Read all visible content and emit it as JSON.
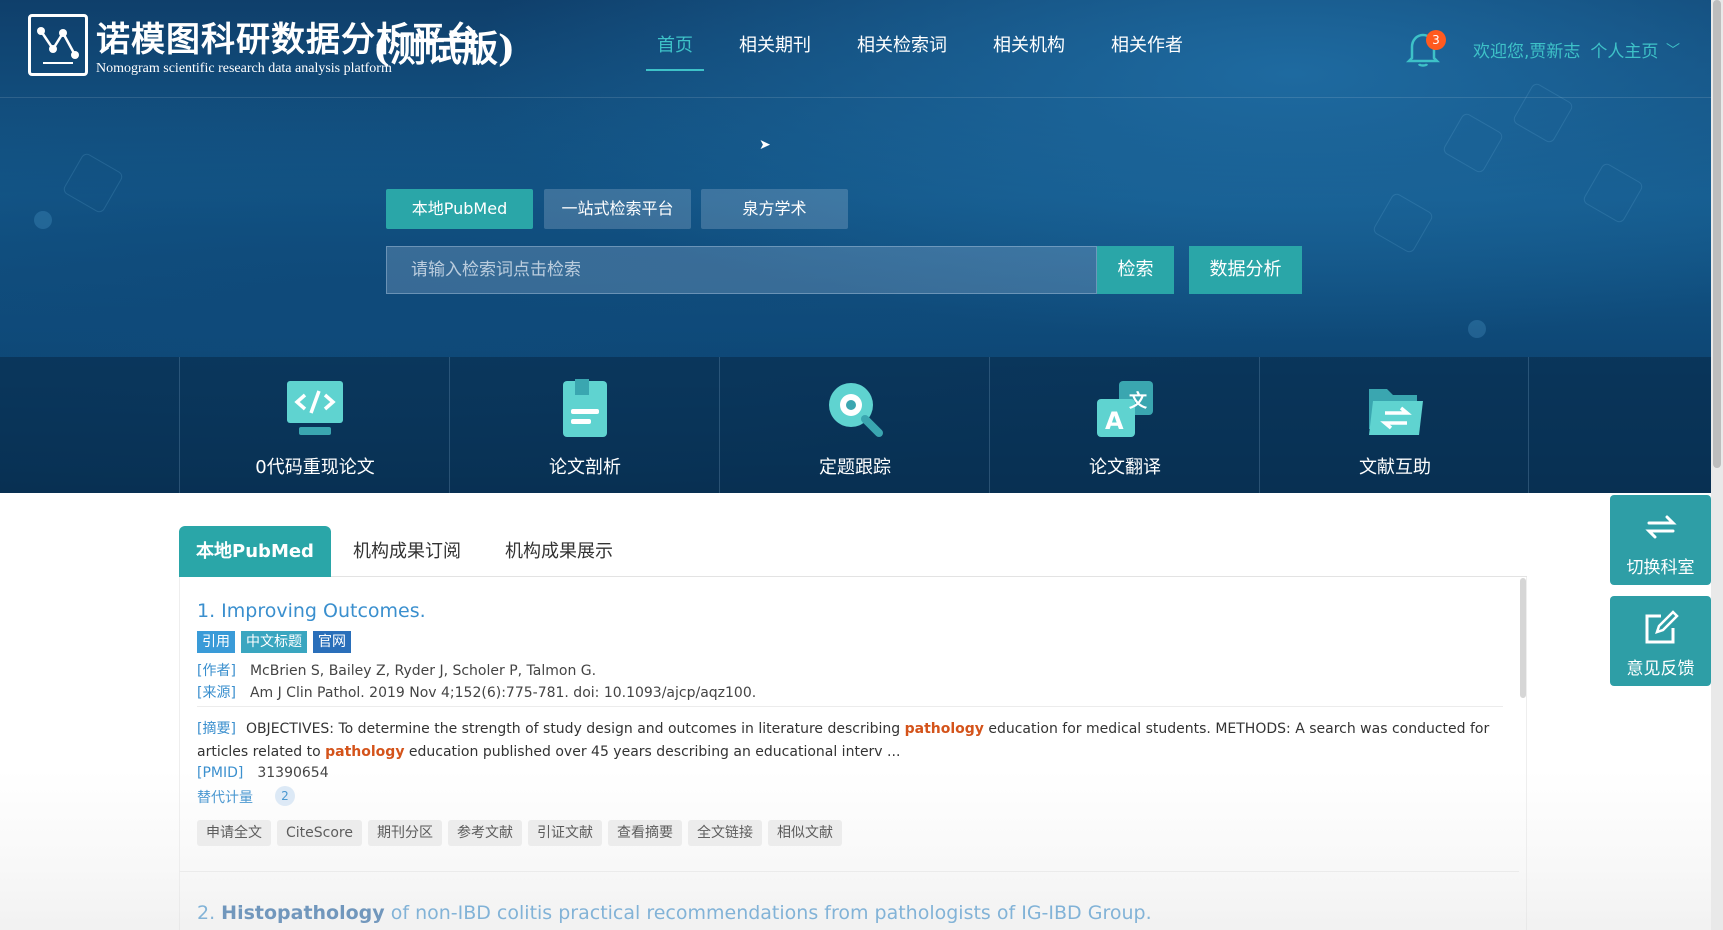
{
  "header": {
    "logo_title": "诺模图科研数据分析平台",
    "logo_subtitle": "Nomogram scientific research data analysis platform",
    "logo_badge": "(测试版)",
    "nav": [
      {
        "label": "首页",
        "active": true
      },
      {
        "label": "相关期刊"
      },
      {
        "label": "相关检索词"
      },
      {
        "label": "相关机构"
      },
      {
        "label": "相关作者"
      }
    ],
    "notification_count": "3",
    "welcome": "欢迎您,贾新志",
    "profile": "个人主页"
  },
  "search": {
    "tabs": [
      "本地PubMed",
      "一站式检索平台",
      "泉方学术"
    ],
    "active_tab": "本地PubMed",
    "placeholder": "请输入检索词点击检索",
    "search_button": "检索",
    "analysis_button": "数据分析"
  },
  "features": [
    {
      "label": "0代码重现论文",
      "icon": "code-icon"
    },
    {
      "label": "论文剖析",
      "icon": "document-icon"
    },
    {
      "label": "定题跟踪",
      "icon": "target-search-icon"
    },
    {
      "label": "论文翻译",
      "icon": "translate-icon"
    },
    {
      "label": "文献互助",
      "icon": "folder-exchange-icon"
    }
  ],
  "floating": {
    "switch_dept": "切换科室",
    "feedback": "意见反馈"
  },
  "content_tabs": [
    "本地PubMed",
    "机构成果订阅",
    "机构成果展示"
  ],
  "articles": [
    {
      "title": "1. Improving Outcomes.",
      "tags": [
        "引用",
        "中文标题",
        "官网"
      ],
      "author_key": "[作者]",
      "authors": "McBrien S, Bailey Z, Ryder J, Scholer P, Talmon G.",
      "source_key": "[来源]",
      "source": "Am J Clin Pathol. 2019 Nov 4;152(6):775-781. doi: 10.1093/ajcp/aqz100.",
      "abstract_key": "[摘要]",
      "abstract_a": "OBJECTIVES: To determine the strength of study design and outcomes in literature describing ",
      "highlight": "pathology",
      "abstract_b": " education for medical students. METHODS: A search was conducted for articles related to ",
      "abstract_c": " education published over 45 years describing an educational interv ...",
      "pmid_key": "[PMID]",
      "pmid": "31390654",
      "alt_metric": "替代计量",
      "alt_count": "2",
      "actions": [
        "申请全文",
        "CiteScore",
        "期刊分区",
        "参考文献",
        "引证文献",
        "查看摘要",
        "全文链接",
        "相似文献"
      ]
    },
    {
      "title_prefix": "2. ",
      "title_bold": "Histopathology",
      "title_rest": " of non-IBD colitis practical recommendations from pathologists of IG-IBD Group."
    }
  ]
}
